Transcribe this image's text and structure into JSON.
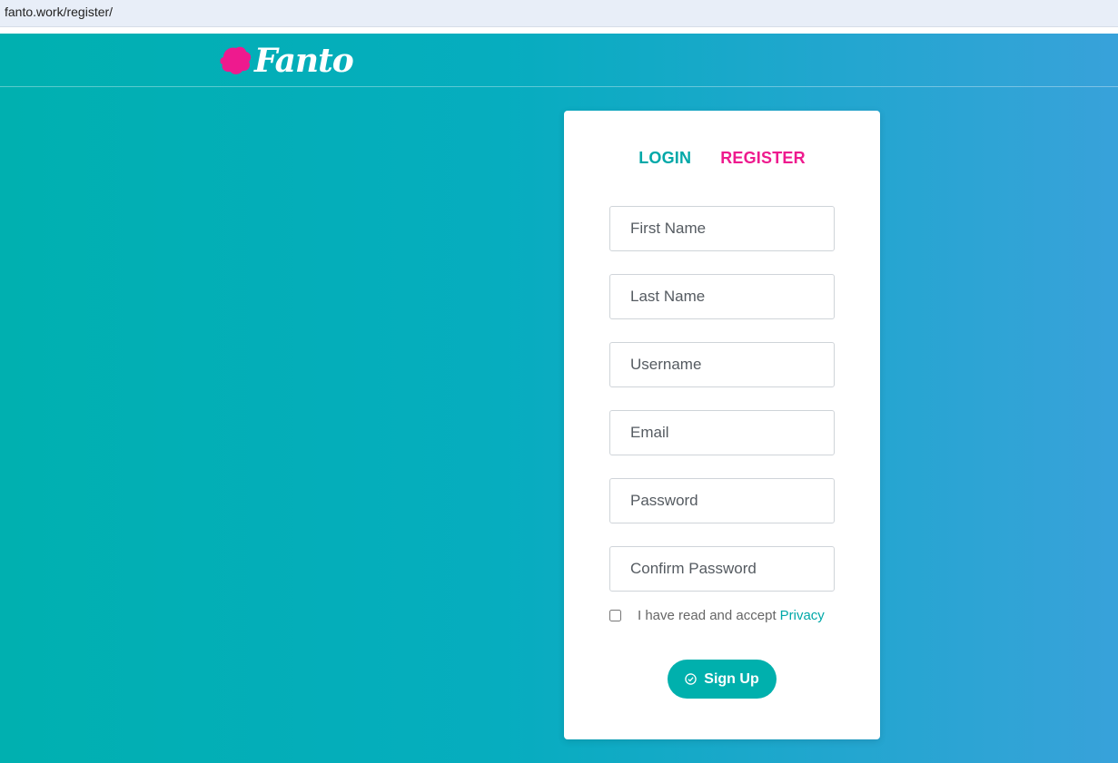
{
  "browser": {
    "url": "fanto.work/register/"
  },
  "brand": {
    "name": "Fanto",
    "mark_color": "#ee1a8e"
  },
  "tabs": {
    "login": "LOGIN",
    "register": "REGISTER"
  },
  "form": {
    "first_name_placeholder": "First Name",
    "last_name_placeholder": "Last Name",
    "username_placeholder": "Username",
    "email_placeholder": "Email",
    "password_placeholder": "Password",
    "confirm_password_placeholder": "Confirm Password",
    "terms_text": "I have read and accept",
    "privacy_link": "Privacy",
    "signup_label": "Sign Up"
  },
  "colors": {
    "accent": "#00b0ad",
    "brand_pink": "#ee1a8e"
  }
}
